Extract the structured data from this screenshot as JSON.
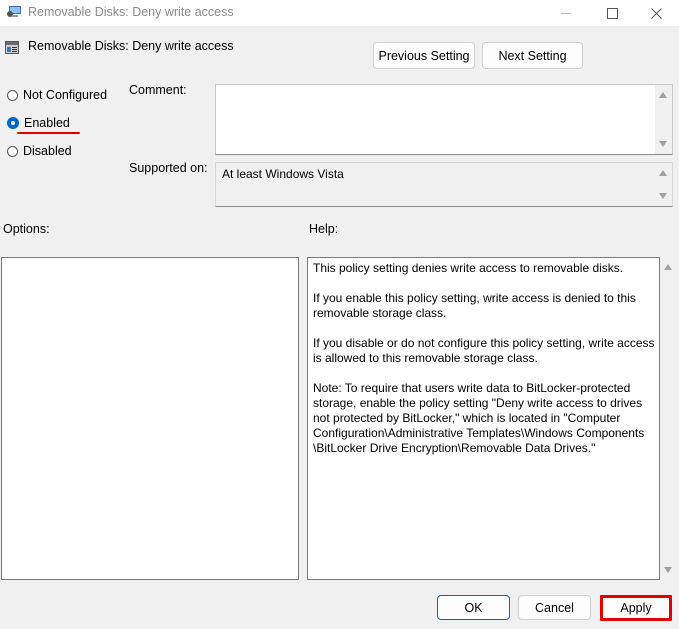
{
  "window": {
    "title": "Removable Disks: Deny write access",
    "controls": [
      "minimize",
      "maximize",
      "close"
    ]
  },
  "header": {
    "setting_name": "Removable Disks: Deny write access",
    "previous_label": "Previous Setting",
    "next_label": "Next Setting"
  },
  "state": {
    "options": [
      {
        "label": "Not Configured",
        "selected": false
      },
      {
        "label": "Enabled",
        "selected": true
      },
      {
        "label": "Disabled",
        "selected": false
      }
    ]
  },
  "comment": {
    "label": "Comment:",
    "value": ""
  },
  "supported": {
    "label": "Supported on:",
    "value": "At least Windows Vista"
  },
  "options_panel": {
    "label": "Options:"
  },
  "help_panel": {
    "label": "Help:",
    "paragraphs": [
      "This policy setting denies write access to removable disks.",
      "If you enable this policy setting, write access is denied to this removable storage class.",
      "If you disable or do not configure this policy setting, write access is allowed to this removable storage class.",
      "Note: To require that users write data to BitLocker-protected storage, enable the policy setting \"Deny write access to drives not protected by BitLocker,\" which is located in \"Computer Configuration\\Administrative Templates\\Windows Components \\BitLocker Drive Encryption\\Removable Data Drives.\""
    ]
  },
  "footer": {
    "ok_label": "OK",
    "cancel_label": "Cancel",
    "apply_label": "Apply"
  },
  "colors": {
    "accent": "#0067c0",
    "highlight": "#e00000"
  }
}
